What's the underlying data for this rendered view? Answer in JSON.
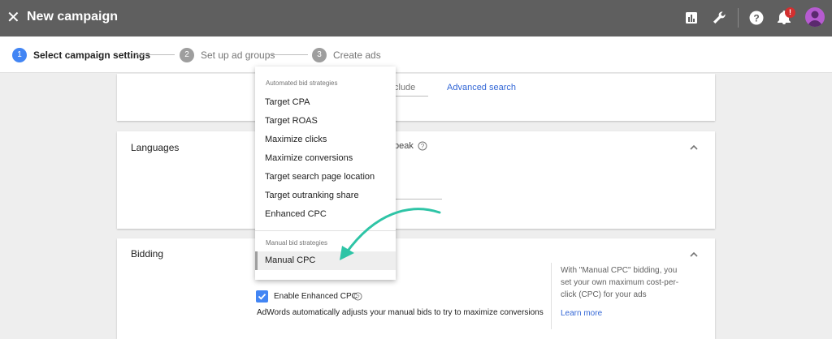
{
  "topbar": {
    "title": "New campaign",
    "notification_badge": "!",
    "icons": [
      "close-icon",
      "reports-icon",
      "tools-icon",
      "help-icon",
      "notifications-icon",
      "account-avatar"
    ]
  },
  "stepper": {
    "steps": [
      {
        "number": "1",
        "label": "Select campaign settings",
        "active": true
      },
      {
        "number": "2",
        "label": "Set up ad groups",
        "active": false
      },
      {
        "number": "3",
        "label": "Create ads",
        "active": false
      }
    ]
  },
  "locations_card": {
    "partial_text": "clude",
    "advanced_search_link": "Advanced search"
  },
  "languages_card": {
    "title": "Languages",
    "partial_text": "peak"
  },
  "bidding_card": {
    "title": "Bidding",
    "checkbox_label": "Enable Enhanced CPC",
    "checkbox_checked": true,
    "description": "AdWords automatically adjusts your manual bids to try to maximize conversions",
    "side_help": "With \"Manual CPC\" bidding, you set your own maximum cost-per-click (CPC) for your ads",
    "learn_more": "Learn more"
  },
  "bid_menu": {
    "automated_header": "Automated bid strategies",
    "automated_items": [
      "Target CPA",
      "Target ROAS",
      "Maximize clicks",
      "Maximize conversions",
      "Target search page location",
      "Target outranking share",
      "Enhanced CPC"
    ],
    "manual_header": "Manual bid strategies",
    "manual_items": [
      "Manual CPC"
    ],
    "selected": "Manual CPC"
  },
  "colors": {
    "topbar": "#5f5f5f",
    "accent_blue": "#4285f4",
    "link_blue": "#3367d6",
    "arrow_teal": "#2ec4a6",
    "badge_red": "#d32f2f",
    "avatar_purple": "#b65bd0"
  }
}
